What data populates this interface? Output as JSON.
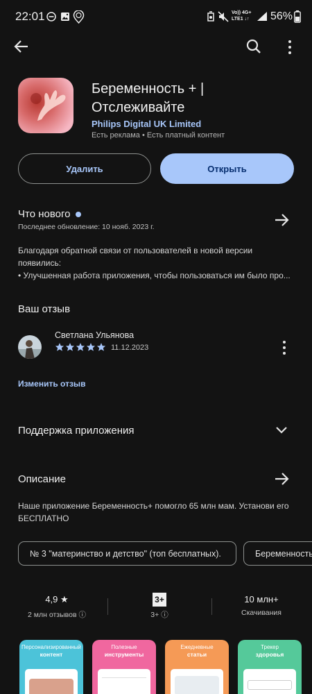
{
  "status_bar": {
    "time": "22:01",
    "network_top": "Vo)) 4G+",
    "network_bottom": "LTE1 ↓↑",
    "battery": "56%"
  },
  "app": {
    "title": "Беременность + | Отслеживайте",
    "developer": "Philips Digital UK Limited",
    "meta": "Есть реклама • Есть платный контент",
    "uninstall_label": "Удалить",
    "open_label": "Открыть"
  },
  "whats_new": {
    "title": "Что нового",
    "updated": "Последнее обновление: 10 нояб. 2023 г.",
    "line1": "Благодаря обратной связи от пользователей в новой версии",
    "line2": "появились:",
    "line3": "• Улучшенная работа приложения, чтобы пользоваться им было про..."
  },
  "review": {
    "section_title": "Ваш отзыв",
    "reviewer": "Светлана Ульянова",
    "rating": 5,
    "date": "11.12.2023",
    "edit_label": "Изменить отзыв"
  },
  "support": {
    "title": "Поддержка приложения"
  },
  "description": {
    "title": "Описание",
    "line1": "Наше приложение Беременность+ помогло 65 млн мам. Установи его",
    "line2": "БЕСПЛАТНО"
  },
  "chips": [
    "№ 3 \"материнство и детство\" (топ бесплатных).",
    "Беременность"
  ],
  "stats": {
    "rating": "4,9",
    "reviews": "2 млн отзывов",
    "age_badge": "3+",
    "age": "3+",
    "downloads": "10 млн+",
    "downloads_label": "Скачивания"
  },
  "screenshots": [
    {
      "line1": "Персонализированный",
      "line2": "контент",
      "color": "#4cc3d9"
    },
    {
      "line1": "Полезные",
      "line2": "инструменты",
      "color": "#f0679f"
    },
    {
      "line1": "Ежедневные",
      "line2": "статьи",
      "color": "#f59a56"
    },
    {
      "line1": "Трекер",
      "line2": "здоровья",
      "color": "#55c99a"
    }
  ],
  "colors": {
    "accent": "#a8c7fa",
    "background": "#131313",
    "star": "#a8c7fa"
  }
}
